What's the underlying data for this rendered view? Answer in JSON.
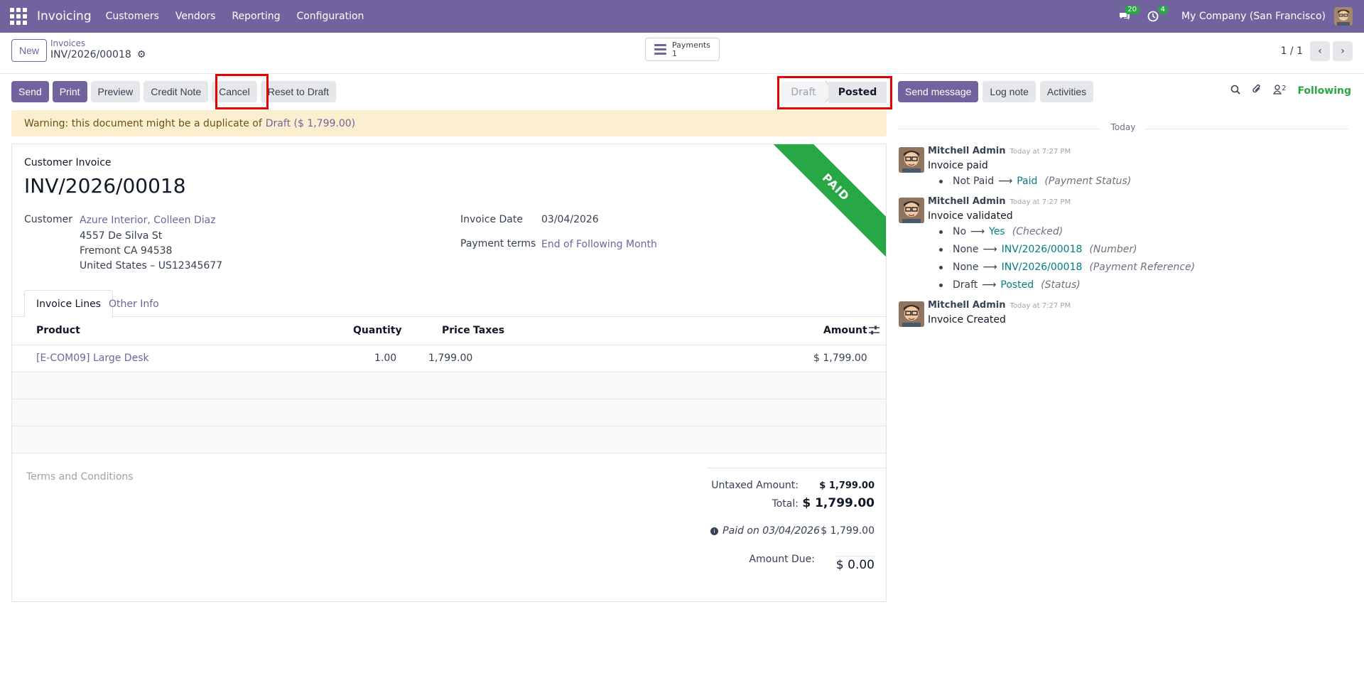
{
  "nav": {
    "app_name": "Invoicing",
    "menu": [
      "Customers",
      "Vendors",
      "Reporting",
      "Configuration"
    ],
    "messages_count": "20",
    "activities_count": "4",
    "company": "My Company (San Francisco)"
  },
  "control": {
    "new_label": "New",
    "breadcrumb_parent": "Invoices",
    "breadcrumb_current": "INV/2026/00018",
    "payments_label": "Payments",
    "payments_count": "1",
    "pager": "1 / 1"
  },
  "actions": {
    "send": "Send",
    "print": "Print",
    "preview": "Preview",
    "credit_note": "Credit Note",
    "cancel": "Cancel",
    "reset": "Reset to Draft"
  },
  "status": {
    "draft": "Draft",
    "posted": "Posted"
  },
  "warning": {
    "text": "Warning: this document might be a duplicate of",
    "link": "Draft ($ 1,799.00)"
  },
  "invoice": {
    "kind": "Customer Invoice",
    "number": "INV/2026/00018",
    "ribbon": "PAID",
    "customer_label": "Customer",
    "customer_name": "Azure Interior, Colleen Diaz",
    "address": [
      "4557 De Silva St",
      "Fremont CA 94538",
      "United States – US12345677"
    ],
    "date_label": "Invoice Date",
    "date_value": "03/04/2026",
    "terms_label": "Payment terms",
    "terms_value": "End of Following Month"
  },
  "tabs": {
    "lines": "Invoice Lines",
    "other": "Other Info"
  },
  "table": {
    "headers": {
      "product": "Product",
      "quantity": "Quantity",
      "price": "Price",
      "taxes": "Taxes",
      "amount": "Amount"
    },
    "rows": [
      {
        "product": "[E-COM09] Large Desk",
        "quantity": "1.00",
        "price": "1,799.00",
        "taxes": "",
        "amount": "$ 1,799.00"
      }
    ]
  },
  "footer": {
    "terms_placeholder": "Terms and Conditions",
    "untaxed_label": "Untaxed Amount:",
    "untaxed_value": "$ 1,799.00",
    "total_label": "Total:",
    "total_value": "$ 1,799.00",
    "paid_label": "Paid on 03/04/2026",
    "paid_value": "$ 1,799.00",
    "due_label": "Amount Due:",
    "due_value": "$ 0.00"
  },
  "chatter": {
    "send_message": "Send message",
    "log_note": "Log note",
    "activities": "Activities",
    "followers_count": "2",
    "following": "Following",
    "today": "Today",
    "messages": [
      {
        "author": "Mitchell Admin",
        "time": "Today at 7:27 PM",
        "body": "Invoice paid",
        "tracking": [
          {
            "old": "Not Paid",
            "new": "Paid",
            "field": "(Payment Status)"
          }
        ]
      },
      {
        "author": "Mitchell Admin",
        "time": "Today at 7:27 PM",
        "body": "Invoice validated",
        "tracking": [
          {
            "old": "No",
            "new": "Yes",
            "field": "(Checked)"
          },
          {
            "old": "None",
            "new": "INV/2026/00018",
            "field": "(Number)"
          },
          {
            "old": "None",
            "new": "INV/2026/00018",
            "field": "(Payment Reference)"
          },
          {
            "old": "Draft",
            "new": "Posted",
            "field": "(Status)"
          }
        ]
      },
      {
        "author": "Mitchell Admin",
        "time": "Today at 7:27 PM",
        "body": "Invoice Created",
        "tracking": []
      }
    ]
  },
  "colors": {
    "brand": "#71639e",
    "paid_ribbon": "#28a745",
    "highlight": "#e30000",
    "warning_bg": "#fcefcf"
  }
}
